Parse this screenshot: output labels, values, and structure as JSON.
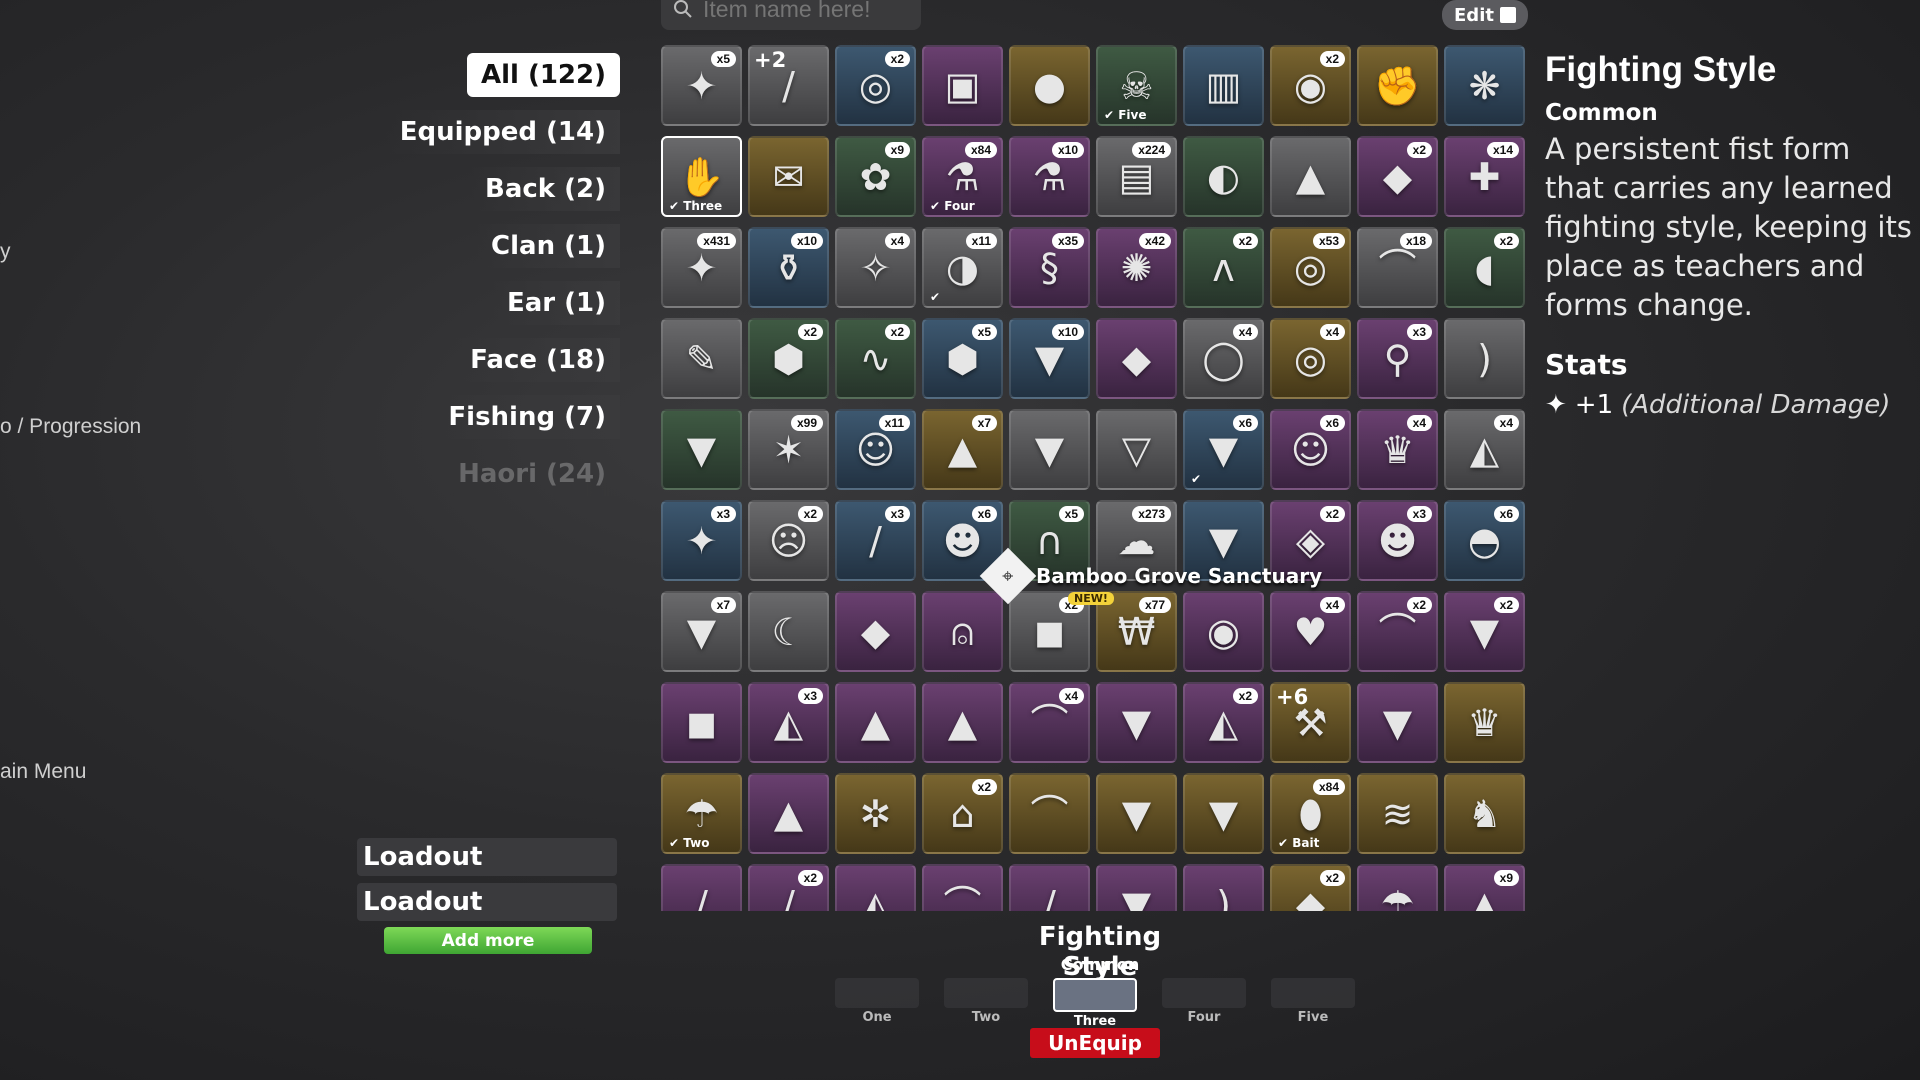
{
  "left_menu": {
    "y_text": "y",
    "progression": "o / Progression",
    "main_menu": "ain Menu"
  },
  "search": {
    "placeholder": "Item name here!",
    "icon": "search-icon"
  },
  "edit": {
    "label": "Edit",
    "icon": "export-icon"
  },
  "categories": [
    {
      "label": "All (122)",
      "active": true
    },
    {
      "label": "Equipped (14)"
    },
    {
      "label": "Back (2)"
    },
    {
      "label": "Clan (1)"
    },
    {
      "label": "Ear (1)"
    },
    {
      "label": "Face (18)"
    },
    {
      "label": "Fishing (7)"
    },
    {
      "label": "Haori (24)"
    }
  ],
  "items": [
    {
      "icon": "✦",
      "color": "grey",
      "qty": "x5",
      "name": "cloth-item"
    },
    {
      "icon": "/",
      "color": "grey",
      "plus": "+2",
      "name": "rifle-item"
    },
    {
      "icon": "◎",
      "color": "blue",
      "qty": "x2",
      "name": "blindfold-item"
    },
    {
      "icon": "▣",
      "color": "purple",
      "name": "spellbook-item"
    },
    {
      "icon": "●",
      "color": "gold",
      "name": "lantern-item"
    },
    {
      "icon": "☠",
      "color": "green",
      "tag": "Five",
      "name": "creature-item"
    },
    {
      "icon": "▥",
      "color": "blue",
      "name": "scarf-item"
    },
    {
      "icon": "◉",
      "color": "gold",
      "qty": "x2",
      "name": "coin-item"
    },
    {
      "icon": "✊",
      "color": "gold",
      "name": "fist-item"
    },
    {
      "icon": "❋",
      "color": "blue",
      "name": "coral-item"
    },
    {
      "icon": "✋",
      "color": "grey",
      "tag": "Three",
      "sel": true,
      "name": "fighting-style-item"
    },
    {
      "icon": "✉",
      "color": "gold",
      "name": "scroll-item"
    },
    {
      "icon": "✿",
      "color": "green",
      "qty": "x9",
      "name": "necklace-item"
    },
    {
      "icon": "⚗",
      "color": "purple",
      "qty": "x84",
      "tag": "Four",
      "name": "potion-item"
    },
    {
      "icon": "⚗",
      "color": "purple",
      "qty": "x10",
      "name": "red-potion-item"
    },
    {
      "icon": "▤",
      "color": "grey",
      "qty": "x224",
      "name": "ore-item"
    },
    {
      "icon": "◐",
      "color": "green",
      "name": "earring-item"
    },
    {
      "icon": "▲",
      "color": "grey",
      "name": "ears-item"
    },
    {
      "icon": "◆",
      "color": "purple",
      "qty": "x2",
      "name": "cape-item"
    },
    {
      "icon": "✚",
      "color": "purple",
      "qty": "x14",
      "name": "robe-item"
    },
    {
      "icon": "✦",
      "color": "grey",
      "qty": "x431",
      "name": "bandage-item"
    },
    {
      "icon": "⚱",
      "color": "blue",
      "qty": "x10",
      "name": "blue-potion-item"
    },
    {
      "icon": "✧",
      "color": "grey",
      "qty": "x4",
      "name": "eyepatch-item"
    },
    {
      "icon": "◑",
      "color": "grey",
      "qty": "x11",
      "tag": "",
      "name": "orb-item"
    },
    {
      "icon": "§",
      "color": "purple",
      "qty": "x35",
      "name": "worm-item"
    },
    {
      "icon": "✺",
      "color": "purple",
      "qty": "x42",
      "name": "red-orb-item"
    },
    {
      "icon": "ʌ",
      "color": "green",
      "qty": "x2",
      "name": "horn-item"
    },
    {
      "icon": "◎",
      "color": "gold",
      "qty": "x53",
      "name": "coins-item"
    },
    {
      "icon": "⌒",
      "color": "grey",
      "qty": "x18",
      "name": "tusk-item"
    },
    {
      "icon": "◖",
      "color": "green",
      "qty": "x2",
      "name": "red-patch-item"
    },
    {
      "icon": "✎",
      "color": "grey",
      "name": "brush-item"
    },
    {
      "icon": "⬢",
      "color": "green",
      "qty": "x2",
      "name": "green-gem-item"
    },
    {
      "icon": "∿",
      "color": "green",
      "qty": "x2",
      "name": "bead-necklace-item"
    },
    {
      "icon": "⬢",
      "color": "blue",
      "qty": "x5",
      "name": "blue-gem-item"
    },
    {
      "icon": "▼",
      "color": "blue",
      "qty": "x10",
      "name": "jacket-item"
    },
    {
      "icon": "◆",
      "color": "purple",
      "name": "ruby-item"
    },
    {
      "icon": "◯",
      "color": "grey",
      "qty": "x4",
      "name": "glasses-item"
    },
    {
      "icon": "◎",
      "color": "gold",
      "qty": "x4",
      "name": "gold-coins-item"
    },
    {
      "icon": "⚲",
      "color": "purple",
      "qty": "x3",
      "name": "earring-red-item"
    },
    {
      "icon": ")",
      "color": "grey",
      "name": "blade-item"
    },
    {
      "icon": "▼",
      "color": "green",
      "name": "green-coat-item"
    },
    {
      "icon": "✶",
      "color": "grey",
      "qty": "x99",
      "name": "antler-item"
    },
    {
      "icon": "☺",
      "color": "blue",
      "qty": "x11",
      "name": "fox-mask-item"
    },
    {
      "icon": "▲",
      "color": "gold",
      "qty": "x7",
      "name": "gold-coat-item"
    },
    {
      "icon": "▼",
      "color": "grey",
      "name": "dark-coat-item"
    },
    {
      "icon": "▽",
      "color": "grey",
      "name": "grey-cloak-item"
    },
    {
      "icon": "▼",
      "color": "blue",
      "qty": "x6",
      "tag": "",
      "name": "teal-coat-item"
    },
    {
      "icon": "☺",
      "color": "purple",
      "qty": "x6",
      "name": "white-mask-item"
    },
    {
      "icon": "♛",
      "color": "purple",
      "qty": "x4",
      "name": "headdress-item"
    },
    {
      "icon": "◭",
      "color": "grey",
      "qty": "x4",
      "name": "hood-item"
    },
    {
      "icon": "✦",
      "color": "blue",
      "qty": "x3",
      "name": "blue-flame-item"
    },
    {
      "icon": "☹",
      "color": "grey",
      "qty": "x2",
      "name": "oni-mask-item"
    },
    {
      "icon": "/",
      "color": "blue",
      "qty": "x3",
      "name": "sword-item"
    },
    {
      "icon": "☻",
      "color": "blue",
      "qty": "x6",
      "name": "demon-mask-item"
    },
    {
      "icon": "∩",
      "color": "green",
      "qty": "x5",
      "name": "teal-necklace-item"
    },
    {
      "icon": "☁",
      "color": "grey",
      "qty": "x273",
      "name": "cloud-item"
    },
    {
      "icon": "▼",
      "color": "blue",
      "name": "ice-coat-item"
    },
    {
      "icon": "◈",
      "color": "purple",
      "qty": "x2",
      "name": "pink-mask-item"
    },
    {
      "icon": "☻",
      "color": "purple",
      "qty": "x3",
      "name": "fox-head-item"
    },
    {
      "icon": "◓",
      "color": "blue",
      "qty": "x6",
      "name": "sleep-mask-item"
    },
    {
      "icon": "▼",
      "color": "grey",
      "qty": "x7",
      "name": "kimono-item"
    },
    {
      "icon": "☾",
      "color": "grey",
      "name": "koi-item"
    },
    {
      "icon": "◆",
      "color": "purple",
      "name": "blue-jewel-item"
    },
    {
      "icon": "⍝",
      "color": "purple",
      "name": "bell-item"
    },
    {
      "icon": "◼",
      "color": "grey",
      "qty": "x2",
      "name": "black-armor-item"
    },
    {
      "icon": "₩",
      "color": "gold",
      "qty": "x77",
      "name": "money-bag-item"
    },
    {
      "icon": "◉",
      "color": "purple",
      "name": "plague-mask-item"
    },
    {
      "icon": "♥",
      "color": "purple",
      "qty": "x4",
      "name": "blue-heart-item"
    },
    {
      "icon": "⌒",
      "color": "purple",
      "qty": "x2",
      "name": "pink-band-item"
    },
    {
      "icon": "▼",
      "color": "purple",
      "qty": "x2",
      "name": "white-coat-item"
    },
    {
      "icon": "◼",
      "color": "purple",
      "name": "shadow-vest-item"
    },
    {
      "icon": "◭",
      "color": "purple",
      "qty": "x3",
      "name": "red-hood-item"
    },
    {
      "icon": "▲",
      "color": "purple",
      "name": "blue-cloak-item"
    },
    {
      "icon": "▲",
      "color": "purple",
      "name": "white-cloak-item"
    },
    {
      "icon": "⌒",
      "color": "purple",
      "qty": "x4",
      "name": "scythe-item"
    },
    {
      "icon": "▼",
      "color": "purple",
      "name": "dark-armor-item"
    },
    {
      "icon": "◭",
      "color": "purple",
      "qty": "x2",
      "name": "ghost-cloak-item"
    },
    {
      "icon": "⚒",
      "color": "gold",
      "plus": "+6",
      "name": "mace-item"
    },
    {
      "icon": "▼",
      "color": "purple",
      "name": "violet-robe-item"
    },
    {
      "icon": "♛",
      "color": "gold",
      "name": "crown-item"
    },
    {
      "icon": "☂",
      "color": "gold",
      "tag": "Two",
      "name": "sedge-hat-item"
    },
    {
      "icon": "▲",
      "color": "purple",
      "name": "lilac-cloak-item"
    },
    {
      "icon": "✲",
      "color": "gold",
      "name": "crab-item"
    },
    {
      "icon": "⌂",
      "color": "gold",
      "qty": "x2",
      "name": "chair-item"
    },
    {
      "icon": "⌒",
      "color": "gold",
      "name": "claw-item"
    },
    {
      "icon": "▼",
      "color": "gold",
      "name": "crimson-coat-item"
    },
    {
      "icon": "▼",
      "color": "gold",
      "name": "fur-cape-item"
    },
    {
      "icon": "⬮",
      "color": "gold",
      "qty": "x84",
      "tag": "Bait",
      "name": "bait-item"
    },
    {
      "icon": "≋",
      "color": "gold",
      "name": "ribbon-item"
    },
    {
      "icon": "♞",
      "color": "gold",
      "name": "horse-item"
    },
    {
      "icon": "/",
      "color": "purple",
      "name": "spear-item"
    },
    {
      "icon": "/",
      "color": "purple",
      "qty": "x2",
      "name": "whip-item"
    },
    {
      "icon": "◭",
      "color": "purple",
      "name": "pink-hood-item"
    },
    {
      "icon": "⌒",
      "color": "purple",
      "name": "kama-item"
    },
    {
      "icon": "/",
      "color": "purple",
      "name": "dagger-item"
    },
    {
      "icon": "▼",
      "color": "purple",
      "name": "grey-robe-item"
    },
    {
      "icon": ")",
      "color": "purple",
      "name": "bow-item"
    },
    {
      "icon": "◆",
      "color": "gold",
      "qty": "x2",
      "name": "idol-item"
    },
    {
      "icon": "☂",
      "color": "purple",
      "name": "straw-hat-item"
    },
    {
      "icon": "▲",
      "color": "purple",
      "qty": "x9",
      "name": "pink-cloak-item"
    }
  ],
  "tooltip": {
    "label": "Bamboo Grove Sanctuary",
    "badge": "NEW!"
  },
  "detail": {
    "title": "Fighting Style",
    "rarity": "Common",
    "description": "A persistent fist form that carries any learned fighting style, keeping its place as teachers and forms change.",
    "stats_heading": "Stats",
    "stat_value": "+1",
    "stat_label": "(Additional Damage)"
  },
  "loadouts": [
    "Loadout",
    "Loadout"
  ],
  "add_more": "Add more",
  "bottom": {
    "title": "Fighting Style",
    "rarity": "Common",
    "slots": [
      "One",
      "Two",
      "Three",
      "Four",
      "Five"
    ],
    "unequip": "UnEquip"
  },
  "colors": {
    "accent": "#ffffff",
    "unequip": "#c70d1a",
    "add_more": "#6bcf4b"
  }
}
